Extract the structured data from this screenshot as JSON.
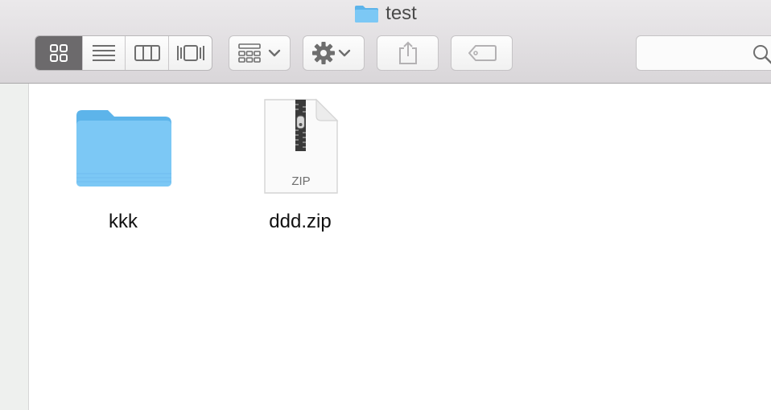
{
  "window": {
    "title": "test"
  },
  "toolbar": {
    "view_modes": [
      {
        "name": "icon-view",
        "active": true
      },
      {
        "name": "list-view",
        "active": false
      },
      {
        "name": "column-view",
        "active": false
      },
      {
        "name": "cover-flow-view",
        "active": false
      }
    ],
    "search": {
      "value": "",
      "placeholder": ""
    }
  },
  "files": [
    {
      "name": "kkk",
      "kind": "folder"
    },
    {
      "name": "ddd.zip",
      "kind": "zip",
      "badge": "ZIP"
    }
  ],
  "colors": {
    "folder": "#7cc8f5",
    "folder_dark": "#5db4ea",
    "active_segment": "#6c6a6c",
    "icon_gray": "#6e6e6e"
  }
}
